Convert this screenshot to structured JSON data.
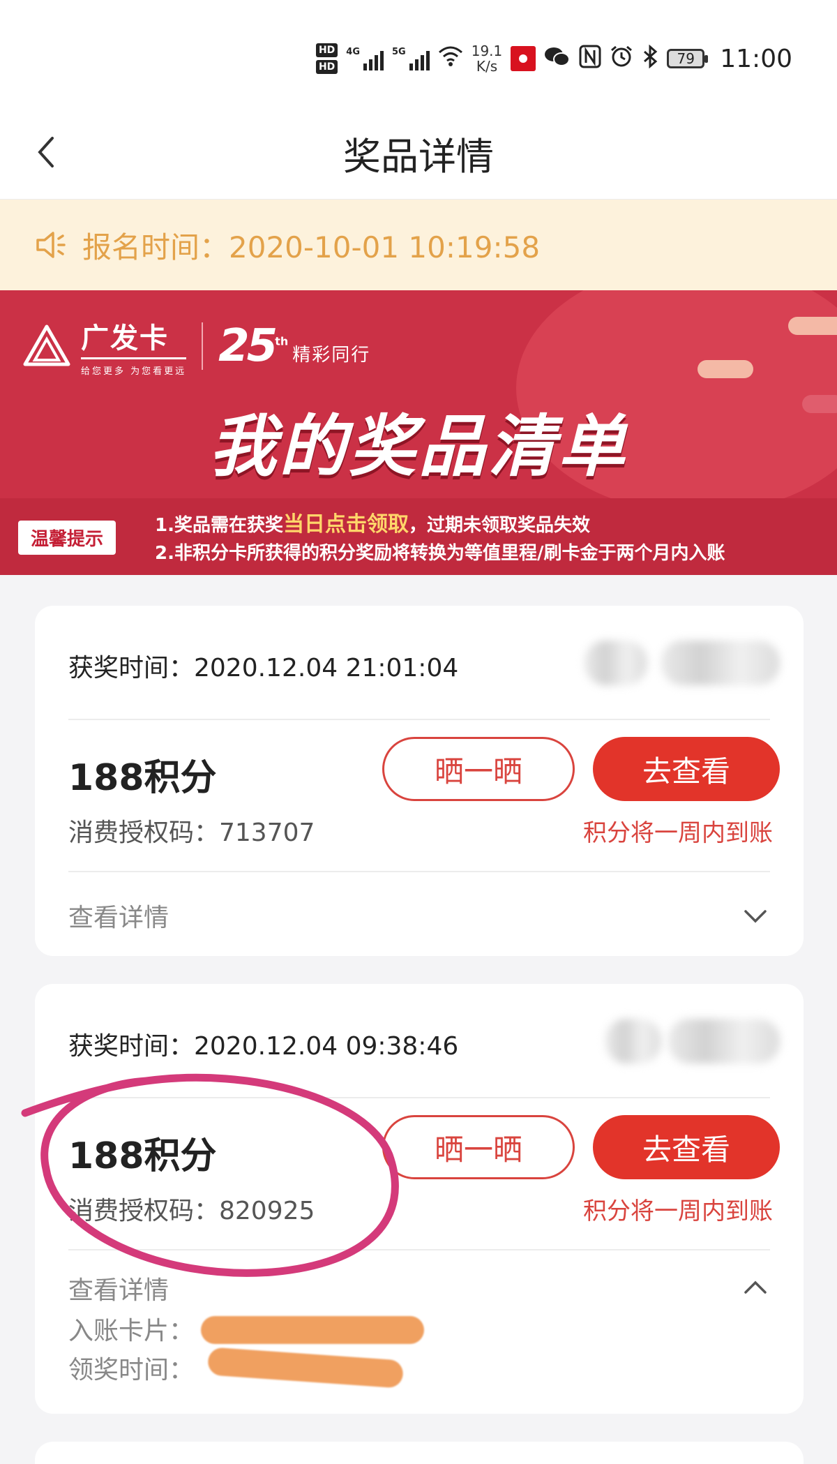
{
  "status_bar": {
    "hd1": "HD",
    "hd2": "HD",
    "net1": "4G",
    "net2": "5G",
    "speed_value": "19.1",
    "speed_unit": "K/s",
    "battery": "79",
    "time": "11:00"
  },
  "header": {
    "title": "奖品详情"
  },
  "notice": {
    "text": "报名时间：2020-10-01 10:19:58"
  },
  "banner": {
    "brand": "广发卡",
    "slogan": "给您更多 为您看更远",
    "anniversary": "25",
    "anniversary_sup": "th",
    "anniversary_text": "精彩同行",
    "title": "我的奖品清单",
    "tip_badge": "温馨提示",
    "tip1_pre": "1.奖品需在获奖",
    "tip1_highlight": "当日点击领取",
    "tip1_post": "，过期未领取奖品失效",
    "tip2": "2.非积分卡所获得的积分奖励将转换为等值里程/刷卡金于两个月内入账"
  },
  "awards": [
    {
      "win_time": "获奖时间：2020.12.04 21:01:04",
      "prize": "188积分",
      "code": "消费授权码：713707",
      "share_label": "晒一晒",
      "view_label": "去查看",
      "arrive_note": "积分将一周内到账",
      "detail_label": "查看详情"
    },
    {
      "win_time": "获奖时间：2020.12.04 09:38:46",
      "prize": "188积分",
      "code": "消费授权码：820925",
      "share_label": "晒一晒",
      "view_label": "去查看",
      "arrive_note": "积分将一周内到账",
      "detail_label": "查看详情",
      "card_label": "入账卡片：",
      "claim_label": "领奖时间："
    }
  ],
  "colors": {
    "accent_red": "#e2342a",
    "notice_text": "#e3a24a",
    "banner_red": "#cb3146",
    "annotation_pink": "#d43a7a",
    "redaction_orange": "#f0a060"
  }
}
